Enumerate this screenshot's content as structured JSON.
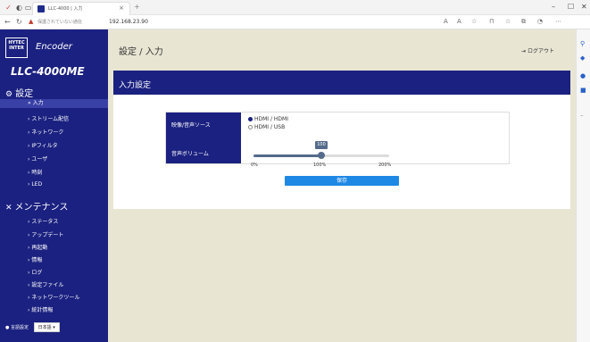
{
  "browser": {
    "tab_title": "LLC-4000 | 入力",
    "security_label": "保護されていない通信",
    "url": "192.168.23.90",
    "window_controls": [
      "–",
      "☐",
      "✕"
    ]
  },
  "app": {
    "logo_text": "HYTEC INTER",
    "product": "Encoder",
    "model": "LLC-4000ME",
    "breadcrumb": "設定 / 入力",
    "logout_label": "ログアウト"
  },
  "sidebar": {
    "settings_heading": "設定",
    "settings_items": [
      {
        "label": "入力",
        "active": true
      },
      {
        "label": "ストリーム配信",
        "active": false
      },
      {
        "label": "ネットワーク",
        "active": false
      },
      {
        "label": "IPフィルタ",
        "active": false
      },
      {
        "label": "ユーザ",
        "active": false
      },
      {
        "label": "時刻",
        "active": false
      },
      {
        "label": "LED",
        "active": false
      }
    ],
    "maintenance_heading": "メンテナンス",
    "maintenance_items": [
      {
        "label": "ステータス"
      },
      {
        "label": "アップデート"
      },
      {
        "label": "再起動"
      },
      {
        "label": "情報"
      },
      {
        "label": "ログ"
      },
      {
        "label": "設定ファイル"
      },
      {
        "label": "ネットワークツール"
      },
      {
        "label": "統計情報"
      }
    ],
    "language_label": "言語設定",
    "language_value": "日本語"
  },
  "panel": {
    "title": "入力設定",
    "source_label": "映像/音声ソース",
    "options": [
      {
        "label": "HDMI / HDMI",
        "selected": true
      },
      {
        "label": "HDMI / USB",
        "selected": false
      }
    ],
    "volume_label": "音声ボリューム",
    "volume_value": "100",
    "volume_level": 0.5,
    "ticks": [
      "0%",
      "100%",
      "200%"
    ],
    "save_label": "保存"
  }
}
